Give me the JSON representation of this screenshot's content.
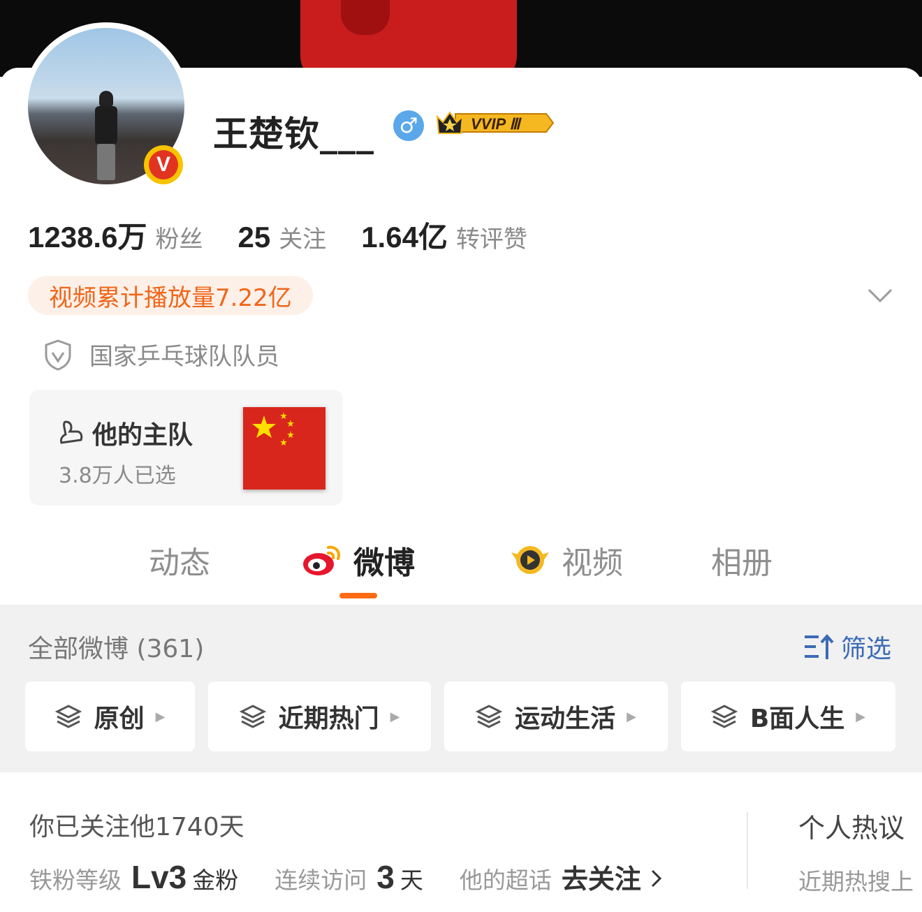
{
  "profile": {
    "username": "王楚钦___",
    "gender_symbol": "♂",
    "verified_badge": "V",
    "vip_badge": "VVIP Ⅲ",
    "stats": [
      {
        "num": "1238.6万",
        "label": "粉丝"
      },
      {
        "num": "25",
        "label": "关注"
      },
      {
        "num": "1.64亿",
        "label": "转评赞"
      }
    ],
    "video_plays": "视频累计播放量7.22亿",
    "verification": "国家乒乓球队队员"
  },
  "team": {
    "title": "他的主队",
    "sub": "3.8万人已选"
  },
  "tabs": [
    {
      "label": "动态",
      "icon": ""
    },
    {
      "label": "微博",
      "icon": "weibo-logo-icon"
    },
    {
      "label": "视频",
      "icon": "video-play-icon"
    },
    {
      "label": "相册",
      "icon": ""
    }
  ],
  "active_tab": "微博",
  "feed": {
    "all_label": "全部微博 (361)",
    "filter_label": "筛选",
    "chips": [
      "原创",
      "近期热门",
      "运动生活",
      "B面人生"
    ]
  },
  "fan_info": {
    "follow_days": "你已关注他1740天",
    "level_label": "铁粉等级",
    "level_value": "Lv3",
    "level_unit": "金粉",
    "visit_label": "连续访问",
    "visit_value": "3",
    "visit_unit": "天",
    "topic_label": "他的超话",
    "topic_action": "去关注",
    "hot_title": "个人热议",
    "hot_sub": "近期热搜上"
  },
  "colors": {
    "accent_orange": "#ff6a13",
    "badge_text": "#f0661a",
    "filter_blue": "#3b6bb5"
  }
}
